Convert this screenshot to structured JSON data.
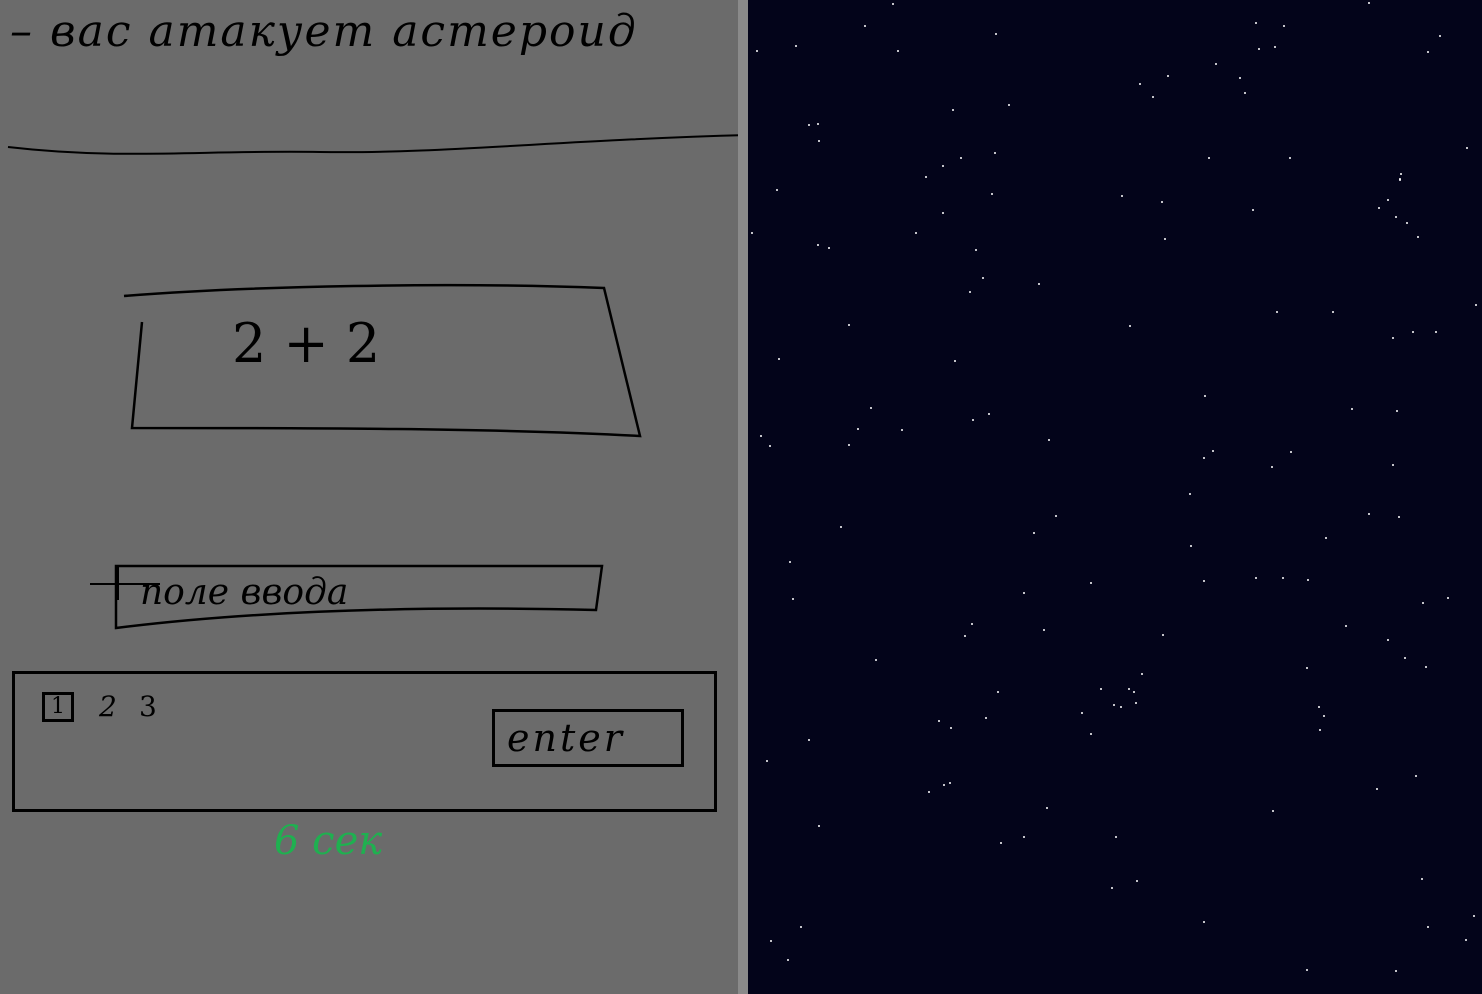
{
  "header": {
    "headline": "– вас атакует астероид"
  },
  "question": {
    "expression": "2 + 2"
  },
  "answer_input": {
    "placeholder": "поле ввода",
    "value": ""
  },
  "pagination": {
    "pages": [
      "1",
      "2",
      "3"
    ],
    "current": "1"
  },
  "enter_button": {
    "label": "enter"
  },
  "timer": {
    "text": "6 сек"
  },
  "colors": {
    "panel_bg": "#6b6b6b",
    "space_bg": "#03041a",
    "timer": "#1fb050",
    "divider": "#8a8a8a"
  }
}
